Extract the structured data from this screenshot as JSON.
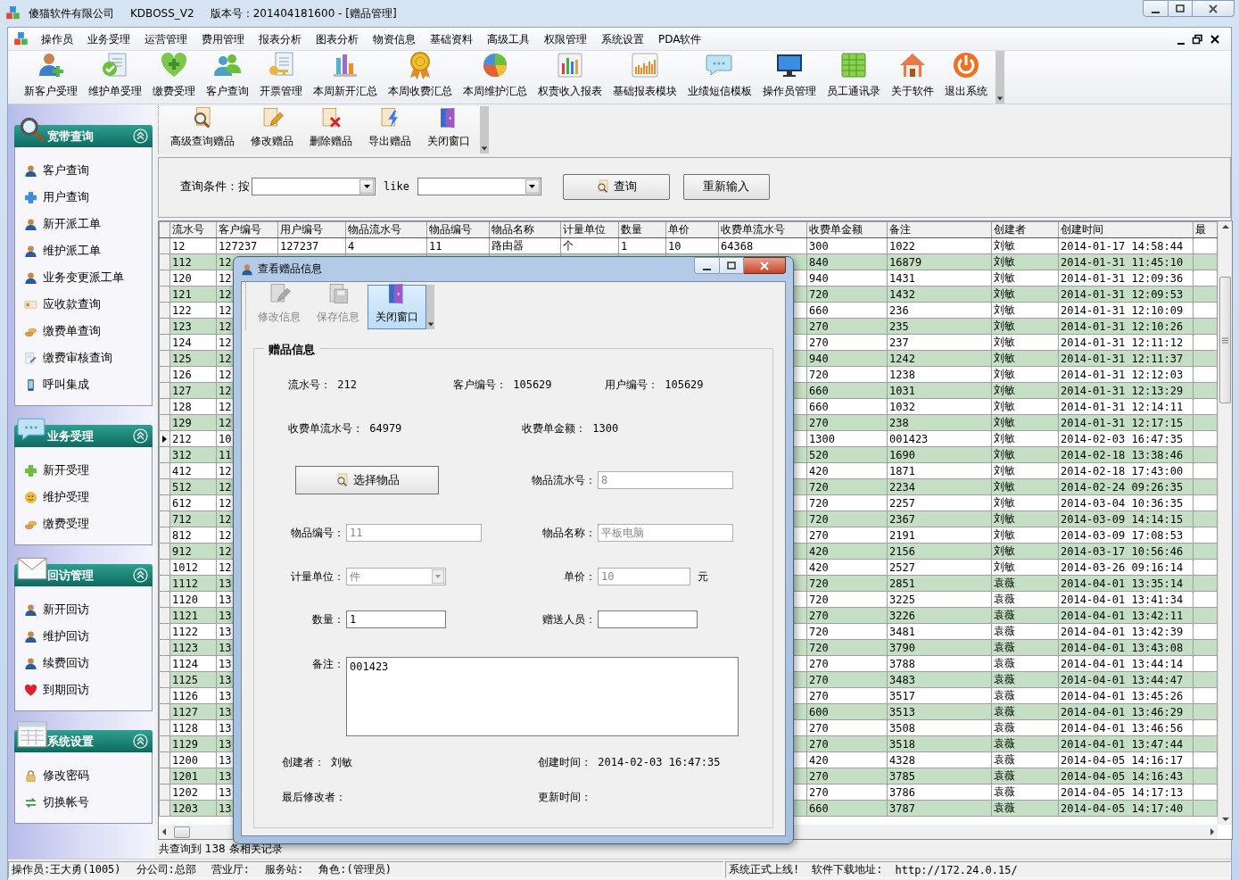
{
  "window": {
    "title_parts": [
      "傻猫软件有限公司",
      "KDBOSS_V2",
      "版本号：201404181600 - [赠品管理]"
    ]
  },
  "menu": [
    "操作员",
    "业务受理",
    "运营管理",
    "费用管理",
    "报表分析",
    "图表分析",
    "物资信息",
    "基础资料",
    "高级工具",
    "权限管理",
    "系统设置",
    "PDA软件"
  ],
  "toolbar": [
    "新客户受理",
    "维护单受理",
    "缴费受理",
    "客户查询",
    "开票管理",
    "本周新开汇总",
    "本周收费汇总",
    "本周维护汇总",
    "权责收入报表",
    "基础报表模块",
    "业绩短信模板",
    "操作员管理",
    "员工通讯录",
    "关于软件",
    "退出系统"
  ],
  "sidebar": [
    {
      "title": "宽带查询",
      "expanded": true,
      "items": [
        "客户查询",
        "用户查询",
        "新开派工单",
        "维护派工单",
        "业务变更派工单",
        "应收款查询",
        "缴费单查询",
        "缴费审核查询",
        "呼叫集成"
      ]
    },
    {
      "title": "业务受理",
      "expanded": true,
      "items": [
        "新开受理",
        "维护受理",
        "缴费受理"
      ]
    },
    {
      "title": "回访管理",
      "expanded": true,
      "items": [
        "新开回访",
        "维护回访",
        "续费回访",
        "到期回访"
      ]
    },
    {
      "title": "系统设置",
      "expanded": true,
      "items": [
        "修改密码",
        "切换帐号"
      ]
    }
  ],
  "sub_toolbar": [
    "高级查询赠品",
    "修改赠品",
    "删除赠品",
    "导出赠品",
    "关闭窗口"
  ],
  "query": {
    "label": "查询条件：按",
    "operator": "like",
    "buttons": [
      "查询",
      "重新输入"
    ]
  },
  "grid": {
    "columns": [
      "流水号",
      "客户编号",
      "用户编号",
      "物品流水号",
      "物品编号",
      "物品名称",
      "计量单位",
      "数量",
      "单价",
      "收费单流水号",
      "收费单金额",
      "备注",
      "创建者",
      "创建时间",
      "最"
    ],
    "rows": [
      {
        "current": false,
        "cells": [
          "12",
          "127237",
          "127237",
          "4",
          "11",
          "路由器",
          "个",
          "1",
          "10",
          "64368",
          "300",
          "1022",
          "刘敏",
          "2014-01-17 14:58:44"
        ]
      },
      {
        "current": false,
        "cells": [
          "112",
          "12",
          null,
          null,
          null,
          null,
          null,
          null,
          null,
          null,
          "840",
          "16879",
          "刘敏",
          "2014-01-31 11:45:10"
        ]
      },
      {
        "current": false,
        "cells": [
          "120",
          "12",
          null,
          null,
          null,
          null,
          null,
          null,
          null,
          null,
          "940",
          "1431",
          "刘敏",
          "2014-01-31 12:09:36"
        ]
      },
      {
        "current": false,
        "cells": [
          "121",
          "12",
          null,
          null,
          null,
          null,
          null,
          null,
          null,
          null,
          "720",
          "1432",
          "刘敏",
          "2014-01-31 12:09:53"
        ]
      },
      {
        "current": false,
        "cells": [
          "122",
          "12",
          null,
          null,
          null,
          null,
          null,
          null,
          null,
          null,
          "660",
          "236",
          "刘敏",
          "2014-01-31 12:10:09"
        ]
      },
      {
        "current": false,
        "cells": [
          "123",
          "12",
          null,
          null,
          null,
          null,
          null,
          null,
          null,
          null,
          "270",
          "235",
          "刘敏",
          "2014-01-31 12:10:26"
        ]
      },
      {
        "current": false,
        "cells": [
          "124",
          "12",
          null,
          null,
          null,
          null,
          null,
          null,
          null,
          null,
          "270",
          "237",
          "刘敏",
          "2014-01-31 12:11:12"
        ]
      },
      {
        "current": false,
        "cells": [
          "125",
          "12",
          null,
          null,
          null,
          null,
          null,
          null,
          null,
          null,
          "940",
          "1242",
          "刘敏",
          "2014-01-31 12:11:37"
        ]
      },
      {
        "current": false,
        "cells": [
          "126",
          "12",
          null,
          null,
          null,
          null,
          null,
          null,
          null,
          null,
          "720",
          "1238",
          "刘敏",
          "2014-01-31 12:12:03"
        ]
      },
      {
        "current": false,
        "cells": [
          "127",
          "12",
          null,
          null,
          null,
          null,
          null,
          null,
          null,
          null,
          "660",
          "1031",
          "刘敏",
          "2014-01-31 12:13:29"
        ]
      },
      {
        "current": false,
        "cells": [
          "128",
          "12",
          null,
          null,
          null,
          null,
          null,
          null,
          null,
          null,
          "660",
          "1032",
          "刘敏",
          "2014-01-31 12:14:11"
        ]
      },
      {
        "current": false,
        "cells": [
          "129",
          "12",
          null,
          null,
          null,
          null,
          null,
          null,
          null,
          null,
          "270",
          "238",
          "刘敏",
          "2014-01-31 12:17:15"
        ]
      },
      {
        "current": true,
        "cells": [
          "212",
          "10",
          null,
          null,
          null,
          null,
          null,
          null,
          null,
          null,
          "1300",
          "001423",
          "刘敏",
          "2014-02-03 16:47:35"
        ]
      },
      {
        "current": false,
        "cells": [
          "312",
          "11",
          null,
          null,
          null,
          null,
          null,
          null,
          null,
          null,
          "520",
          "1690",
          "刘敏",
          "2014-02-18 13:38:46"
        ]
      },
      {
        "current": false,
        "cells": [
          "412",
          "12",
          null,
          null,
          null,
          null,
          null,
          null,
          null,
          null,
          "420",
          "1871",
          "刘敏",
          "2014-02-18 17:43:00"
        ]
      },
      {
        "current": false,
        "cells": [
          "512",
          "12",
          null,
          null,
          null,
          null,
          null,
          null,
          null,
          null,
          "720",
          "2234",
          "刘敏",
          "2014-02-24 09:26:35"
        ]
      },
      {
        "current": false,
        "cells": [
          "612",
          "12",
          null,
          null,
          null,
          null,
          null,
          null,
          null,
          null,
          "720",
          "2257",
          "刘敏",
          "2014-03-04 10:36:35"
        ]
      },
      {
        "current": false,
        "cells": [
          "712",
          "12",
          null,
          null,
          null,
          null,
          null,
          null,
          null,
          null,
          "720",
          "2367",
          "刘敏",
          "2014-03-09 14:14:15"
        ]
      },
      {
        "current": false,
        "cells": [
          "812",
          "12",
          null,
          null,
          null,
          null,
          null,
          null,
          null,
          null,
          "270",
          "2191",
          "刘敏",
          "2014-03-09 17:08:53"
        ]
      },
      {
        "current": false,
        "cells": [
          "912",
          "12",
          null,
          null,
          null,
          null,
          null,
          null,
          null,
          null,
          "420",
          "2156",
          "刘敏",
          "2014-03-17 10:56:46"
        ]
      },
      {
        "current": false,
        "cells": [
          "1012",
          "12",
          null,
          null,
          null,
          null,
          null,
          null,
          null,
          null,
          "420",
          "2527",
          "刘敏",
          "2014-03-26 09:16:14"
        ]
      },
      {
        "current": false,
        "cells": [
          "1112",
          "13",
          null,
          null,
          null,
          null,
          null,
          null,
          null,
          null,
          "720",
          "2851",
          "袁薇",
          "2014-04-01 13:35:14"
        ]
      },
      {
        "current": false,
        "cells": [
          "1120",
          "13",
          null,
          null,
          null,
          null,
          null,
          null,
          null,
          null,
          "720",
          "3225",
          "袁薇",
          "2014-04-01 13:41:34"
        ]
      },
      {
        "current": false,
        "cells": [
          "1121",
          "13",
          null,
          null,
          null,
          null,
          null,
          null,
          null,
          null,
          "270",
          "3226",
          "袁薇",
          "2014-04-01 13:42:11"
        ]
      },
      {
        "current": false,
        "cells": [
          "1122",
          "13",
          null,
          null,
          null,
          null,
          null,
          null,
          null,
          null,
          "720",
          "3481",
          "袁薇",
          "2014-04-01 13:42:39"
        ]
      },
      {
        "current": false,
        "cells": [
          "1123",
          "13",
          null,
          null,
          null,
          null,
          null,
          null,
          null,
          null,
          "720",
          "3790",
          "袁薇",
          "2014-04-01 13:43:08"
        ]
      },
      {
        "current": false,
        "cells": [
          "1124",
          "13",
          null,
          null,
          null,
          null,
          null,
          null,
          null,
          null,
          "270",
          "3788",
          "袁薇",
          "2014-04-01 13:44:14"
        ]
      },
      {
        "current": false,
        "cells": [
          "1125",
          "13",
          null,
          null,
          null,
          null,
          null,
          null,
          null,
          null,
          "270",
          "3483",
          "袁薇",
          "2014-04-01 13:44:47"
        ]
      },
      {
        "current": false,
        "cells": [
          "1126",
          "13",
          null,
          null,
          null,
          null,
          null,
          null,
          null,
          null,
          "270",
          "3517",
          "袁薇",
          "2014-04-01 13:45:26"
        ]
      },
      {
        "current": false,
        "cells": [
          "1127",
          "13",
          null,
          null,
          null,
          null,
          null,
          null,
          null,
          null,
          "600",
          "3513",
          "袁薇",
          "2014-04-01 13:46:29"
        ]
      },
      {
        "current": false,
        "cells": [
          "1128",
          "13",
          null,
          null,
          null,
          null,
          null,
          null,
          null,
          null,
          "270",
          "3508",
          "袁薇",
          "2014-04-01 13:46:56"
        ]
      },
      {
        "current": false,
        "cells": [
          "1129",
          "13",
          null,
          null,
          null,
          null,
          null,
          null,
          null,
          null,
          "270",
          "3518",
          "袁薇",
          "2014-04-01 13:47:44"
        ]
      },
      {
        "current": false,
        "cells": [
          "1200",
          "13",
          null,
          null,
          null,
          null,
          null,
          null,
          null,
          null,
          "420",
          "4328",
          "袁薇",
          "2014-04-05 14:16:17"
        ]
      },
      {
        "current": false,
        "cells": [
          "1201",
          "13",
          null,
          null,
          null,
          null,
          null,
          null,
          null,
          null,
          "270",
          "3785",
          "袁薇",
          "2014-04-05 14:16:43"
        ]
      },
      {
        "current": false,
        "cells": [
          "1202",
          "13",
          null,
          null,
          null,
          null,
          null,
          null,
          null,
          null,
          "270",
          "3786",
          "袁薇",
          "2014-04-05 14:17:13"
        ]
      },
      {
        "current": false,
        "cells": [
          "1203",
          "13",
          null,
          null,
          null,
          null,
          null,
          null,
          null,
          null,
          "660",
          "3787",
          "袁薇",
          "2014-04-05 14:17:40"
        ]
      }
    ],
    "record_count": "共查询到 138 条相关记录"
  },
  "status_bar": {
    "left": [
      "操作员:王大勇(1005)",
      "分公司:总部",
      "营业厅:",
      "服务站:",
      "角色:(管理员)"
    ],
    "right": [
      "系统正式上线!",
      "软件下载地址:",
      "http://172.24.0.15/"
    ]
  },
  "dialog": {
    "title": "查看赠品信息",
    "tools": [
      {
        "label": "修改信息",
        "disabled": true,
        "pressed": false
      },
      {
        "label": "保存信息",
        "disabled": true,
        "pressed": false
      },
      {
        "label": "关闭窗口",
        "disabled": false,
        "pressed": true
      }
    ],
    "group_title": "赠品信息",
    "summary": [
      [
        {
          "label": "流水号：",
          "value": "212"
        },
        {
          "label": "客户编号：",
          "value": "105629"
        },
        {
          "label": "用户编号：",
          "value": "105629"
        }
      ],
      [
        {
          "label": "收费单流水号：",
          "value": "64979"
        },
        {
          "label": "收费单金额：",
          "value": "1300"
        }
      ]
    ],
    "form": [
      [
        {
          "kind": "button",
          "label": "选择物品"
        },
        {
          "kind": "input",
          "label": "物品流水号：",
          "value": "8",
          "disabled": true
        }
      ],
      [
        {
          "kind": "input",
          "label": "物品编号：",
          "value": "11",
          "disabled": true
        },
        {
          "kind": "input",
          "label": "物品名称：",
          "value": "平板电脑",
          "disabled": true
        }
      ],
      [
        {
          "kind": "combo",
          "label": "计量单位：",
          "value": "件",
          "disabled": true
        },
        {
          "kind": "input",
          "label": "单价：",
          "value": "10",
          "disabled": true,
          "unit": "元"
        }
      ],
      [
        {
          "kind": "input",
          "label": "数量：",
          "value": "1",
          "disabled": false
        },
        {
          "kind": "input",
          "label": "赠送人员：",
          "disabled": false
        }
      ]
    ],
    "remark": {
      "label": "备注：",
      "value": "001423"
    },
    "footer": [
      [
        {
          "label": "创建者：",
          "value": "刘敏"
        },
        {
          "label": "创建时间：",
          "value": "2014-02-03 16:47:35"
        }
      ],
      [
        {
          "label": "最后修改者："
        },
        {
          "label": "更新时间："
        }
      ]
    ]
  }
}
